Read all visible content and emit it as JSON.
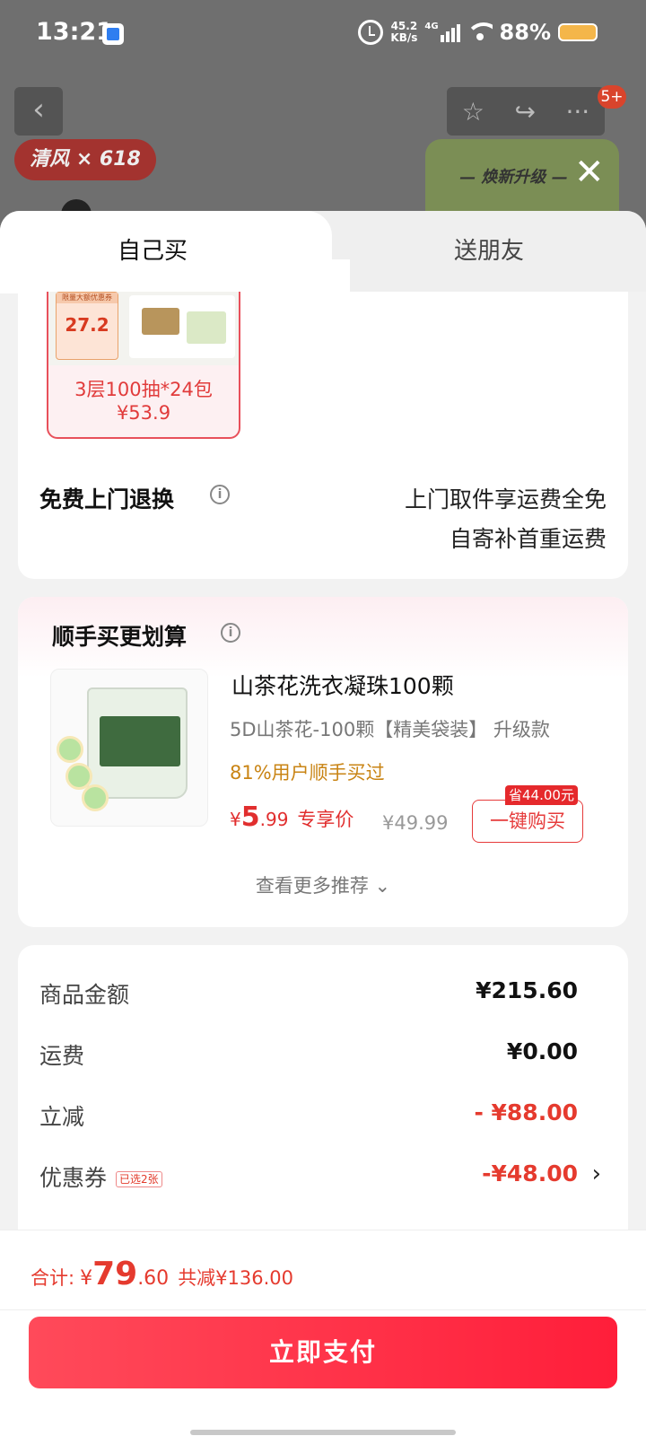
{
  "status_bar": {
    "time": "13:21",
    "net_speed_value": "45.2",
    "net_speed_unit": "KB/s",
    "network": "4G",
    "battery": "88%"
  },
  "background": {
    "brand_text": "清风 × 618",
    "upgrade_text": "— 焕新升级 —",
    "badge": "5+"
  },
  "tabs": {
    "self": "自己买",
    "friend": "送朋友"
  },
  "sku": {
    "tag_title": "限量大额优惠券",
    "tag_price": "27.2",
    "spec": "3层100抽*24包",
    "price": "¥53.9"
  },
  "return_service": {
    "label": "免费上门退换",
    "line1": "上门取件享运费全免",
    "line2": "自寄补首重运费"
  },
  "recommend": {
    "title": "顺手买更划算",
    "product_name": "山茶花洗衣凝珠100颗",
    "product_spec": "5D山茶花-100颗【精美袋装】 升级款",
    "social_proof": "81%用户顺手买过",
    "price_currency": "¥",
    "price_int": "5",
    "price_dec": ".99",
    "price_tag": "专享价",
    "original_price": "¥49.99",
    "save_badge": "省44.00元",
    "buy_button": "一键购买",
    "more": "查看更多推荐 ⌄"
  },
  "summary": {
    "rows": [
      {
        "label": "商品金额",
        "value": "¥215.60"
      },
      {
        "label": "运费",
        "value": "¥0.00"
      },
      {
        "label": "立减",
        "value": "- ¥88.00"
      },
      {
        "label": "优惠券",
        "tag": "已选2张",
        "value": "-¥48.00"
      }
    ]
  },
  "footer": {
    "total_label": "合计:",
    "currency": "¥",
    "total_int": "79",
    "total_dec": ".60",
    "saved": "共减¥136.00",
    "pay_button": "立即支付"
  }
}
